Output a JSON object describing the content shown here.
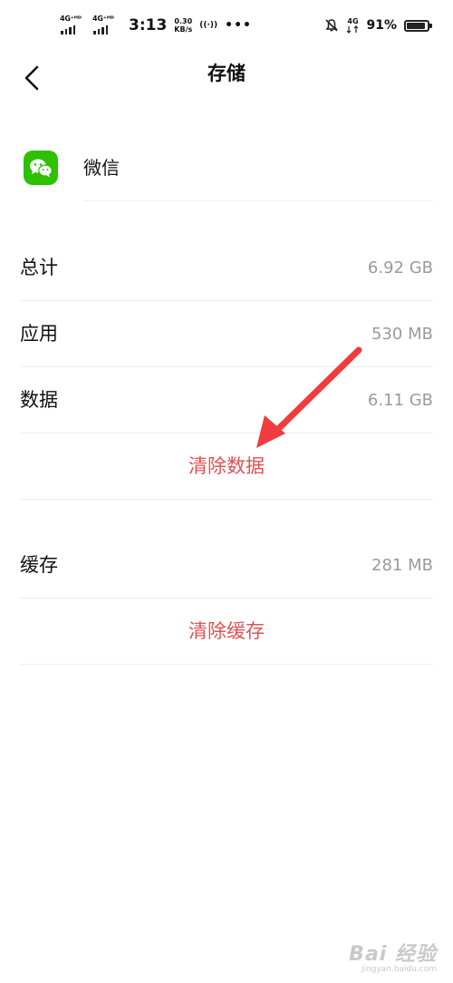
{
  "status_bar": {
    "network1": "4G⁺ᴴᴰ",
    "network2": "4G⁺ᴴᴰ",
    "time": "3:13",
    "speed_value": "0.30",
    "speed_unit": "KB/s",
    "hotspot": "((·))",
    "more": "•••",
    "net_right": "4G",
    "battery": "91%",
    "battery_level": 0.91
  },
  "header": {
    "title": "存储"
  },
  "app": {
    "name": "微信"
  },
  "storage": {
    "total_label": "总计",
    "total_value": "6.92 GB",
    "app_label": "应用",
    "app_value": "530 MB",
    "data_label": "数据",
    "data_value": "6.11 GB",
    "clear_data_label": "清除数据",
    "cache_label": "缓存",
    "cache_value": "281 MB",
    "clear_cache_label": "清除缓存"
  },
  "colors": {
    "accent": "#e05252",
    "arrow": "#f03c3c",
    "wechat_green": "#2dc100"
  },
  "watermark": {
    "main": "Bai 经验",
    "sub": "jingyan.baidu.com"
  }
}
